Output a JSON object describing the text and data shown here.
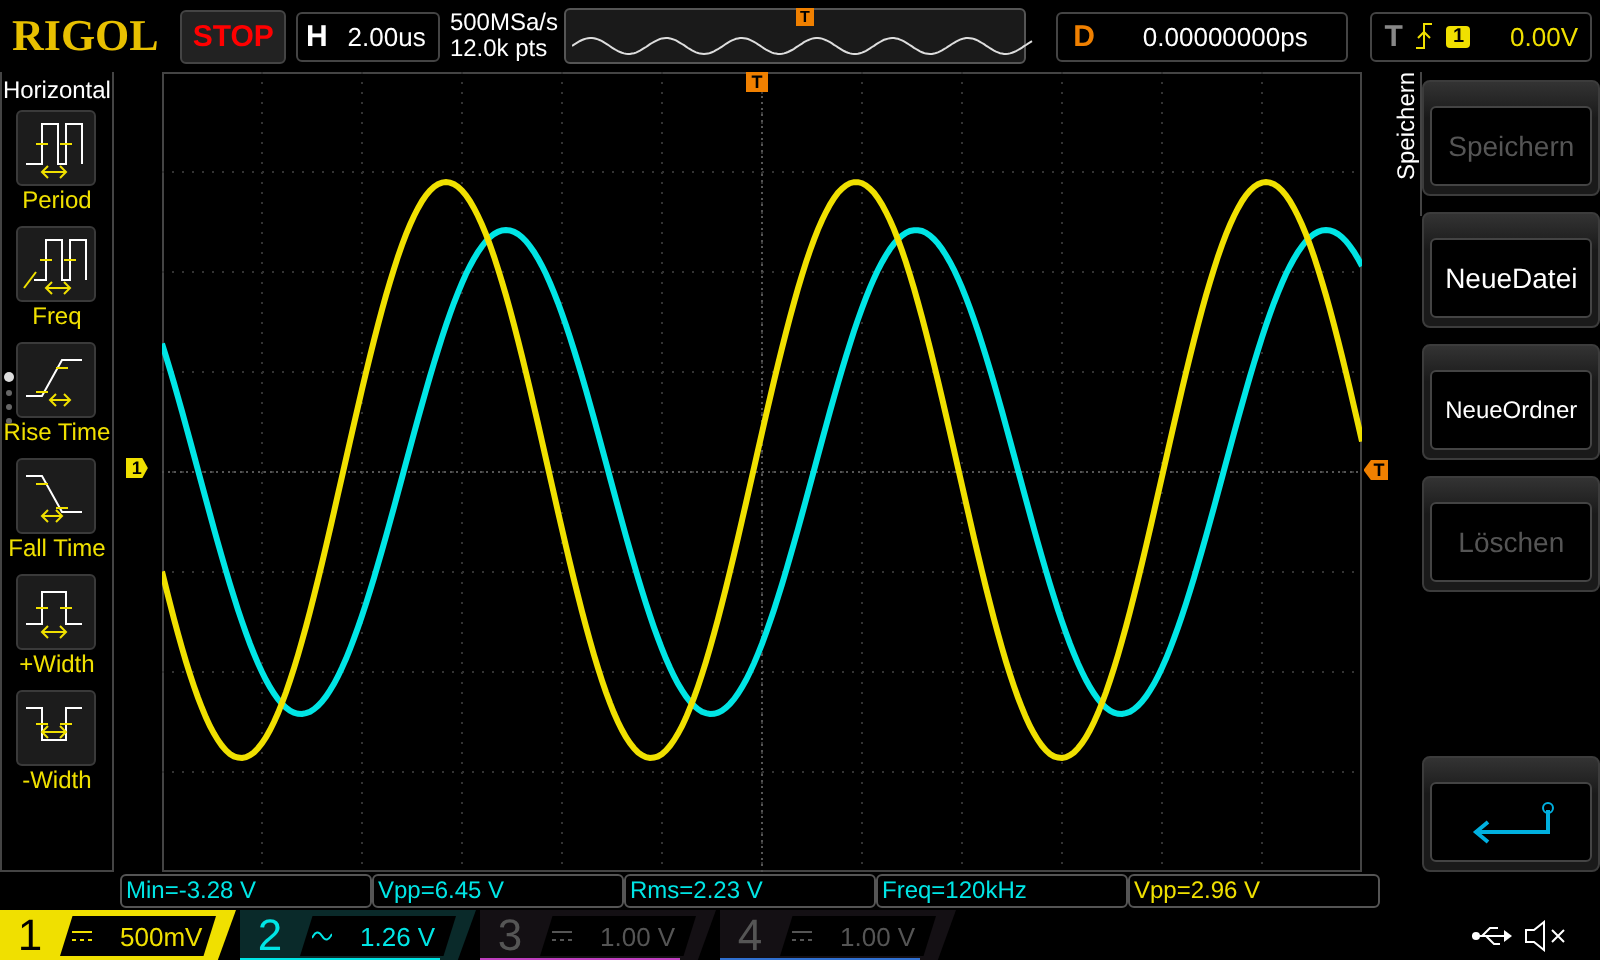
{
  "header": {
    "logo": "RIGOL",
    "run_state": "STOP",
    "timebase": {
      "label": "H",
      "value": "2.00us"
    },
    "sample_rate": "500MSa/s",
    "memory_depth": "12.0k pts",
    "waveform_overview": {
      "trigger_marker": "T"
    },
    "delay": {
      "label": "D",
      "value": "0.00000000ps"
    },
    "trigger": {
      "label": "T",
      "channel": "1",
      "level": "0.00V"
    }
  },
  "left_menu": {
    "title": "Horizontal",
    "items": [
      {
        "label": "Period",
        "kind": "period"
      },
      {
        "label": "Freq",
        "kind": "freq"
      },
      {
        "label": "Rise Time",
        "kind": "rise"
      },
      {
        "label": "Fall Time",
        "kind": "fall"
      },
      {
        "label": "+Width",
        "kind": "pwidth"
      },
      {
        "label": "-Width",
        "kind": "nwidth"
      }
    ],
    "pages": [
      {
        "selected": true
      },
      {
        "selected": false
      },
      {
        "selected": false
      },
      {
        "selected": false
      }
    ]
  },
  "graticule": {
    "channel_marker": "1",
    "trigger_marker_top": "T",
    "trigger_marker_right": "T"
  },
  "right_menu": {
    "title": "Speichern",
    "items": [
      {
        "kind": "text",
        "label": "Speichern",
        "disabled": true
      },
      {
        "kind": "text",
        "label": "NeueDatei",
        "disabled": false
      },
      {
        "kind": "text",
        "label": "NeueOrdner",
        "disabled": false
      },
      {
        "kind": "text",
        "label": "Löschen",
        "disabled": true
      },
      {
        "kind": "spacer"
      },
      {
        "kind": "return",
        "disabled": false
      }
    ]
  },
  "measurements": [
    {
      "text": "Min=-3.28 V",
      "color": "#00e5e5"
    },
    {
      "text": "Vpp=6.45 V",
      "color": "#00e5e5"
    },
    {
      "text": "Rms=2.23 V",
      "color": "#00e5e5"
    },
    {
      "text": "Freq=120kHz",
      "color": "#00e5e5"
    },
    {
      "text": "Vpp=2.96 V",
      "color": "#f0e000"
    }
  ],
  "channels": [
    {
      "number": "1",
      "kind": "dc",
      "scale": "500mV",
      "enabled": true,
      "selected": true,
      "color": "#f0e000"
    },
    {
      "number": "2",
      "kind": "ac",
      "scale": "1.26 V",
      "enabled": true,
      "selected": false,
      "color": "#00e5e5"
    },
    {
      "number": "3",
      "kind": "dc",
      "scale": "1.00 V",
      "enabled": false,
      "selected": false,
      "color": "#c040c0"
    },
    {
      "number": "4",
      "kind": "dc",
      "scale": "1.00 V",
      "enabled": false,
      "selected": false,
      "color": "#3070d0"
    }
  ]
}
